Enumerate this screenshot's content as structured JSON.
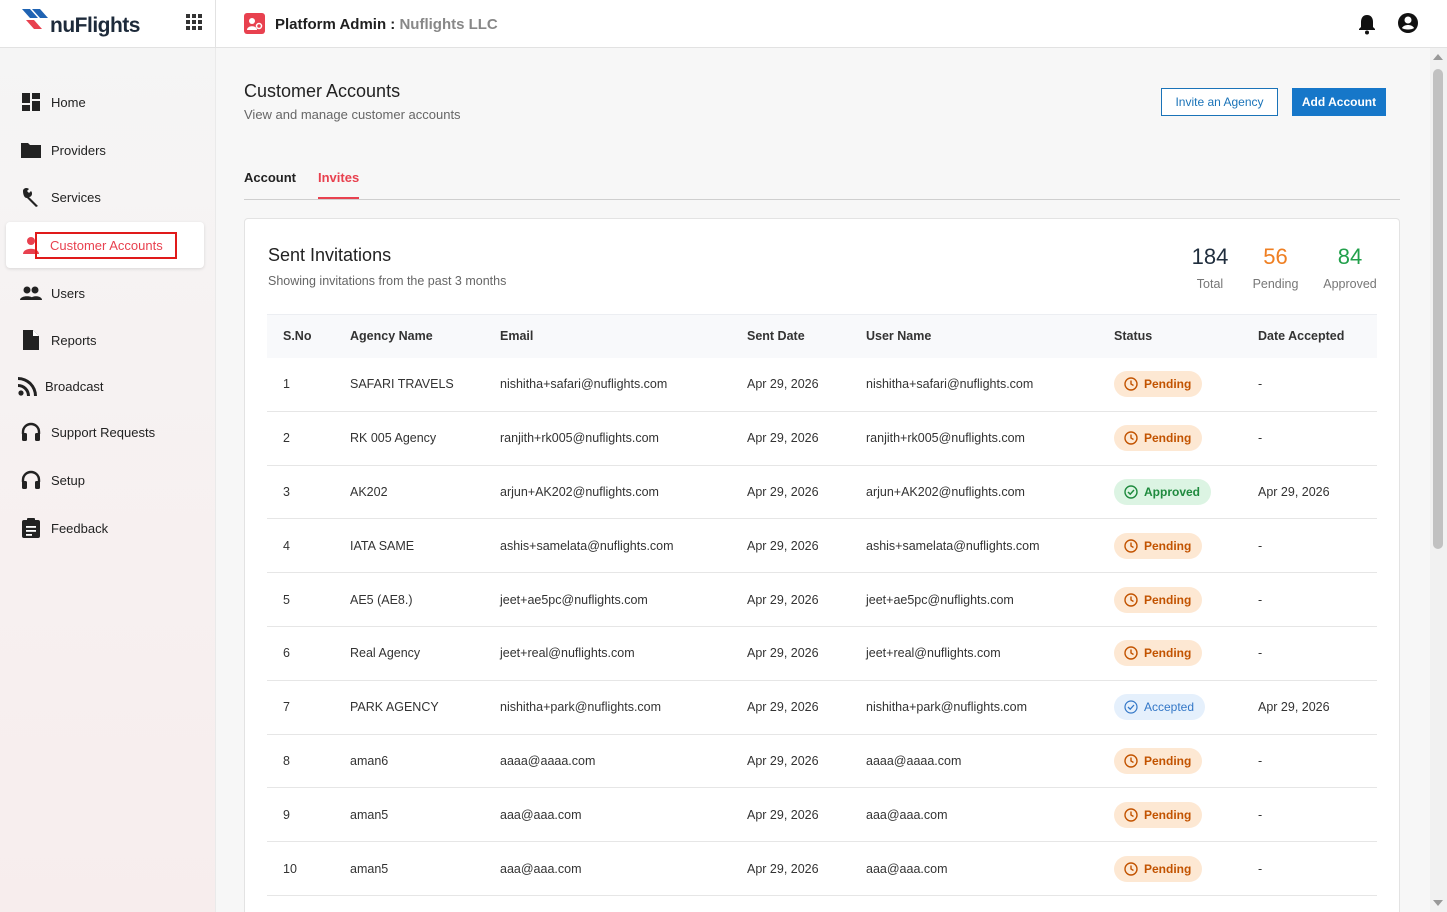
{
  "brand": {
    "logo_prefix": "nu",
    "logo_suffix": "Flights",
    "accent_color": "#e8414f",
    "primary_color": "#1677c9"
  },
  "header": {
    "title": "Platform Admin :",
    "org": "Nuflights LLC"
  },
  "sidebar": {
    "items": [
      {
        "label": "Home",
        "icon": "dashboard-icon"
      },
      {
        "label": "Providers",
        "icon": "folder-icon"
      },
      {
        "label": "Services",
        "icon": "wrench-icon"
      },
      {
        "label": "Customer Accounts",
        "icon": "person-icon",
        "active": true
      },
      {
        "label": "Users",
        "icon": "group-icon"
      },
      {
        "label": "Reports",
        "icon": "document-icon"
      },
      {
        "label": "Broadcast",
        "icon": "rss-icon"
      },
      {
        "label": "Support Requests",
        "icon": "headset-icon"
      },
      {
        "label": "Setup",
        "icon": "headset-icon"
      },
      {
        "label": "Feedback",
        "icon": "clipboard-icon"
      }
    ]
  },
  "page": {
    "title": "Customer Accounts",
    "subtitle": "View and manage customer accounts",
    "invite_button": "Invite an Agency",
    "add_button": "Add Account",
    "tabs": [
      {
        "label": "Account"
      },
      {
        "label": "Invites",
        "active": true
      }
    ]
  },
  "card": {
    "title": "Sent Invitations",
    "subtitle": "Showing invitations from the past 3 months",
    "stats": {
      "total": {
        "value": "184",
        "label": "Total"
      },
      "pending": {
        "value": "56",
        "label": "Pending"
      },
      "approved": {
        "value": "84",
        "label": "Approved"
      }
    }
  },
  "table": {
    "columns": [
      "S.No",
      "Agency Name",
      "Email",
      "Sent Date",
      "User Name",
      "Status",
      "Date Accepted"
    ],
    "rows": [
      {
        "sno": "1",
        "agency": "SAFARI TRAVELS",
        "email": "nishitha+safari@nuflights.com",
        "sent": "Apr 29, 2026",
        "user": "nishitha+safari@nuflights.com",
        "status": "Pending",
        "accepted": "-"
      },
      {
        "sno": "2",
        "agency": "RK 005 Agency",
        "email": "ranjith+rk005@nuflights.com",
        "sent": "Apr 29, 2026",
        "user": "ranjith+rk005@nuflights.com",
        "status": "Pending",
        "accepted": "-"
      },
      {
        "sno": "3",
        "agency": "AK202",
        "email": "arjun+AK202@nuflights.com",
        "sent": "Apr 29, 2026",
        "user": "arjun+AK202@nuflights.com",
        "status": "Approved",
        "accepted": "Apr 29, 2026"
      },
      {
        "sno": "4",
        "agency": "IATA SAME",
        "email": "ashis+samelata@nuflights.com",
        "sent": "Apr 29, 2026",
        "user": "ashis+samelata@nuflights.com",
        "status": "Pending",
        "accepted": "-"
      },
      {
        "sno": "5",
        "agency": "AE5 (AE8.)",
        "email": "jeet+ae5pc@nuflights.com",
        "sent": "Apr 29, 2026",
        "user": "jeet+ae5pc@nuflights.com",
        "status": "Pending",
        "accepted": "-"
      },
      {
        "sno": "6",
        "agency": "Real Agency",
        "email": "jeet+real@nuflights.com",
        "sent": "Apr 29, 2026",
        "user": "jeet+real@nuflights.com",
        "status": "Pending",
        "accepted": "-"
      },
      {
        "sno": "7",
        "agency": "PARK AGENCY",
        "email": "nishitha+park@nuflights.com",
        "sent": "Apr 29, 2026",
        "user": "nishitha+park@nuflights.com",
        "status": "Accepted",
        "accepted": "Apr 29, 2026"
      },
      {
        "sno": "8",
        "agency": "aman6",
        "email": "aaaa@aaaa.com",
        "sent": "Apr 29, 2026",
        "user": "aaaa@aaaa.com",
        "status": "Pending",
        "accepted": "-"
      },
      {
        "sno": "9",
        "agency": "aman5",
        "email": "aaa@aaa.com",
        "sent": "Apr 29, 2026",
        "user": "aaa@aaa.com",
        "status": "Pending",
        "accepted": "-"
      },
      {
        "sno": "10",
        "agency": "aman5",
        "email": "aaa@aaa.com",
        "sent": "Apr 29, 2026",
        "user": "aaa@aaa.com",
        "status": "Pending",
        "accepted": "-"
      }
    ]
  }
}
